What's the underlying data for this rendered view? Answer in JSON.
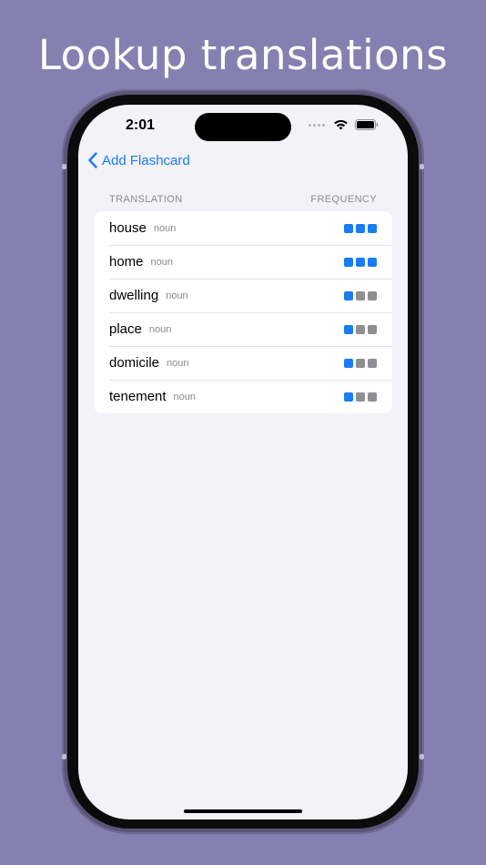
{
  "headline": "Lookup translations",
  "status_bar": {
    "time": "2:01",
    "icons": [
      "cellular-signal-icon",
      "wifi-icon",
      "battery-icon"
    ]
  },
  "nav": {
    "back_label": "Add Flashcard",
    "back_icon": "chevron-left-icon"
  },
  "section": {
    "left_header": "TRANSLATION",
    "right_header": "FREQUENCY"
  },
  "colors": {
    "background": "#8580B0",
    "accent": "#1A7CF4",
    "freq_on": "#1A7CF4",
    "freq_off": "#8E8E93"
  },
  "translations": [
    {
      "word": "house",
      "pos": "noun",
      "frequency": 3
    },
    {
      "word": "home",
      "pos": "noun",
      "frequency": 3
    },
    {
      "word": "dwelling",
      "pos": "noun",
      "frequency": 1
    },
    {
      "word": "place",
      "pos": "noun",
      "frequency": 1
    },
    {
      "word": "domicile",
      "pos": "noun",
      "frequency": 1
    },
    {
      "word": "tenement",
      "pos": "noun",
      "frequency": 1
    }
  ],
  "frequency_max": 3
}
